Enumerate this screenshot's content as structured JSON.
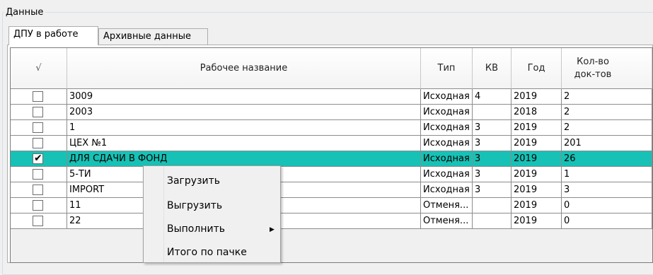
{
  "group_title": "Данные",
  "tabs": [
    {
      "label": "ДПУ в работе",
      "active": true
    },
    {
      "label": "Архивные данные",
      "active": false
    }
  ],
  "table": {
    "check_header": "√",
    "columns": [
      "Рабочее название",
      "Тип",
      "КВ",
      "Год",
      "Кол-во док-тов"
    ],
    "rows": [
      {
        "checked": false,
        "name": "3009",
        "type": "Исходная",
        "kv": "4",
        "year": "2019",
        "count": "2"
      },
      {
        "checked": false,
        "name": "2003",
        "type": "Исходная",
        "kv": "",
        "year": "2018",
        "count": "2"
      },
      {
        "checked": false,
        "name": "1",
        "type": "Исходная",
        "kv": "3",
        "year": "2019",
        "count": "2"
      },
      {
        "checked": false,
        "name": "ЦЕХ №1",
        "type": "Исходная",
        "kv": "3",
        "year": "2019",
        "count": "201"
      },
      {
        "checked": true,
        "selected": true,
        "name": "ДЛЯ СДАЧИ В ФОНД",
        "type": "Исходная",
        "kv": "3",
        "year": "2019",
        "count": "26"
      },
      {
        "checked": false,
        "name": "5-ТИ",
        "type": "Исходная",
        "kv": "3",
        "year": "2019",
        "count": "1"
      },
      {
        "checked": false,
        "name": "IMPORT",
        "type": "Исходная",
        "kv": "3",
        "year": "2019",
        "count": "3"
      },
      {
        "checked": false,
        "name": "11",
        "type": "Отменя...",
        "kv": "",
        "year": "2019",
        "count": "0"
      },
      {
        "checked": false,
        "name": "22",
        "type": "Отменя...",
        "kv": "",
        "year": "2019",
        "count": "0"
      }
    ]
  },
  "context_menu": {
    "items": [
      "Загрузить",
      "Выгрузить",
      "Выполнить",
      "Итого по пачке"
    ],
    "submenu_arrow": "▶"
  },
  "colors": {
    "selection": "#17c1b5"
  }
}
